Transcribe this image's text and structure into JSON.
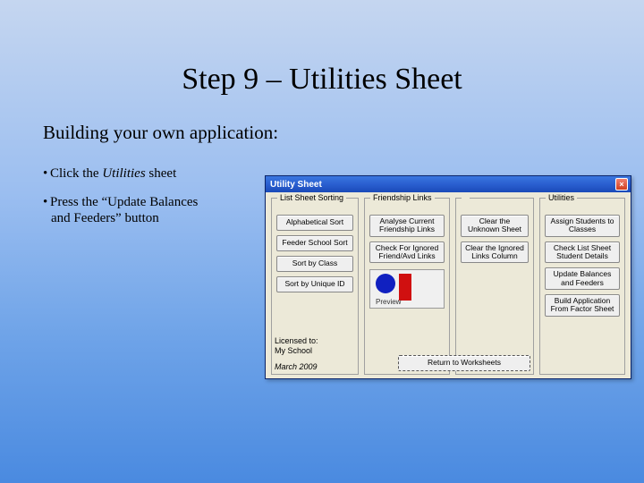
{
  "title": "Step 9 – Utilities Sheet",
  "subtitle": "Building your own application:",
  "bullets": {
    "b1_pre": "Click the ",
    "b1_em": "Utilities",
    "b1_post": " sheet",
    "b2_line1": "Press the “Update Balances",
    "b2_line2": "and Feeders” button"
  },
  "dialog": {
    "title": "Utility Sheet",
    "groups": {
      "sorting": "List Sheet Sorting",
      "links": "Friendship Links",
      "util": "Utilities"
    },
    "buttons": {
      "alpha": "Alphabetical Sort",
      "feeder": "Feeder School Sort",
      "byclass": "Sort by Class",
      "byid": "Sort by Unique ID",
      "analyse": "Analyse Current Friendship Links",
      "ignored": "Check For Ignored Friend/Avd Links",
      "clearunk": "Clear the Unknown Sheet",
      "clearign": "Clear the Ignored Links Column",
      "assign": "Assign Students to Classes",
      "checklist": "Check List Sheet Student Details",
      "update": "Update Balances and Feeders",
      "build": "Build Application From Factor Sheet",
      "return": "Return to Worksheets"
    },
    "preview_label": "Preview",
    "licensed_label": "Licensed to:",
    "licensed_name": "My School",
    "date": "March 2009"
  }
}
